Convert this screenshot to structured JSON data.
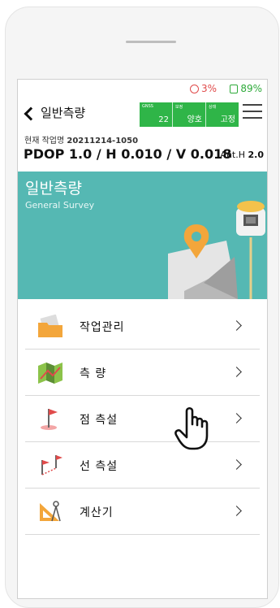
{
  "status": {
    "low_battery": "3%",
    "battery": "89%",
    "low_color": "#e04b4b",
    "ok_color": "#2eaa3a"
  },
  "nav": {
    "back_icon": "chevron-left-icon",
    "title": "일반측량",
    "menu_icon": "hamburger-menu-icon"
  },
  "gnss_status": {
    "color": "#2fb548",
    "cols": [
      {
        "label": "GNSS",
        "value": "22"
      },
      {
        "label": "보정",
        "value": "양호"
      },
      {
        "label": "상태",
        "value": "고정"
      }
    ]
  },
  "job": {
    "label": "현재 작업명",
    "name": "20211214-1050"
  },
  "precision": {
    "text": "PDOP 1.0 / H 0.010 / V 0.018",
    "ant_label": "Ant.H",
    "ant_value": "2.0"
  },
  "hero": {
    "title": "일반측량",
    "subtitle": "General Survey",
    "color": "#55b8b3"
  },
  "menu": [
    {
      "label": "작업관리",
      "icon": "folder-icon"
    },
    {
      "label": "측 량",
      "icon": "map-icon"
    },
    {
      "label": "점 측설",
      "icon": "flag-icon"
    },
    {
      "label": "선 측설",
      "icon": "two-flags-icon"
    },
    {
      "label": "계산기",
      "icon": "compass-triangle-icon"
    }
  ],
  "cursor": {
    "icon": "hand-pointer-icon"
  }
}
